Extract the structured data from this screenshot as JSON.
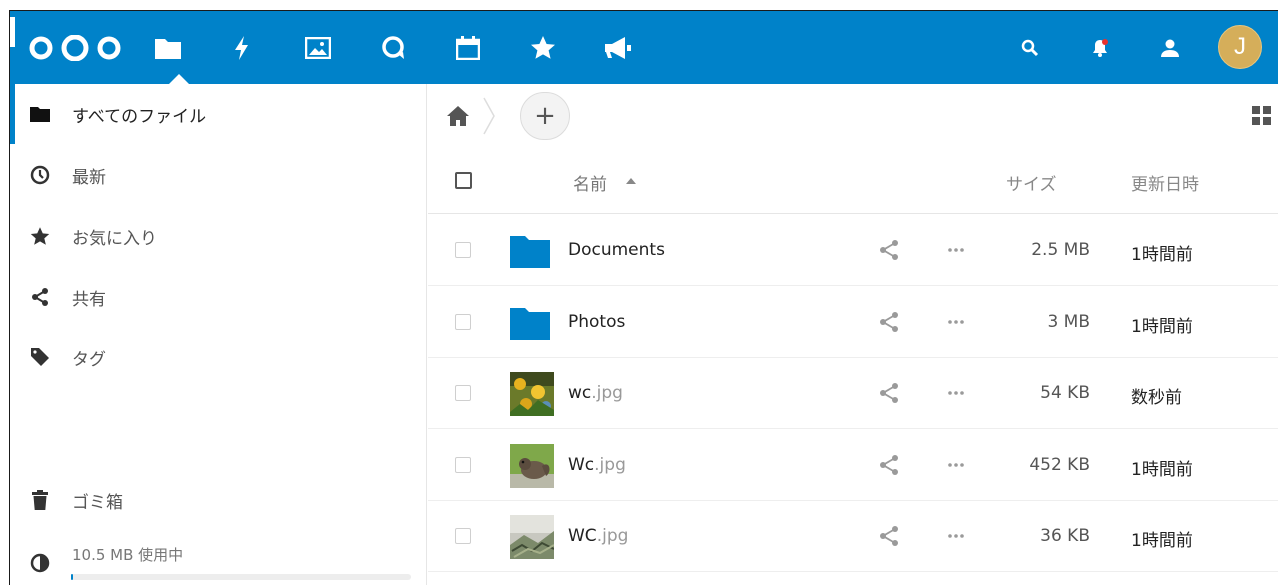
{
  "colors": {
    "header": "#0082c9",
    "avatar": "#d5ae5a",
    "folder": "#0082c9"
  },
  "header": {
    "apps": [
      {
        "name": "files-icon",
        "active": true
      },
      {
        "name": "activity-icon"
      },
      {
        "name": "gallery-icon"
      },
      {
        "name": "talk-icon"
      },
      {
        "name": "calendar-icon"
      },
      {
        "name": "favorites-icon"
      },
      {
        "name": "announcements-icon"
      }
    ],
    "avatar_initial": "J"
  },
  "sidebar": {
    "items": [
      {
        "label": "すべてのファイル",
        "icon": "folder-icon"
      },
      {
        "label": "最新",
        "icon": "clock-icon"
      },
      {
        "label": "お気に入り",
        "icon": "star-icon"
      },
      {
        "label": "共有",
        "icon": "share-icon"
      },
      {
        "label": "タグ",
        "icon": "tag-icon"
      }
    ],
    "trash_label": "ゴミ箱",
    "quota_label": "10.5 MB 使用中",
    "quota_fraction": 0.005
  },
  "main": {
    "columns": {
      "name": "名前",
      "size": "サイズ",
      "modified": "更新日時"
    },
    "files": [
      {
        "base": "Documents",
        "ext": "",
        "type": "folder",
        "size": "2.5 MB",
        "modified": "1時間前"
      },
      {
        "base": "Photos",
        "ext": "",
        "type": "folder",
        "size": "3 MB",
        "modified": "1時間前"
      },
      {
        "base": "wc",
        "ext": ".jpg",
        "type": "image",
        "thumb": "flowers",
        "size": "54 KB",
        "modified": "数秒前"
      },
      {
        "base": "Wc",
        "ext": ".jpg",
        "type": "image",
        "thumb": "squirrel",
        "size": "452 KB",
        "modified": "1時間前"
      },
      {
        "base": "WC",
        "ext": ".jpg",
        "type": "image",
        "thumb": "leaves",
        "size": "36 KB",
        "modified": "1時間前"
      }
    ]
  }
}
